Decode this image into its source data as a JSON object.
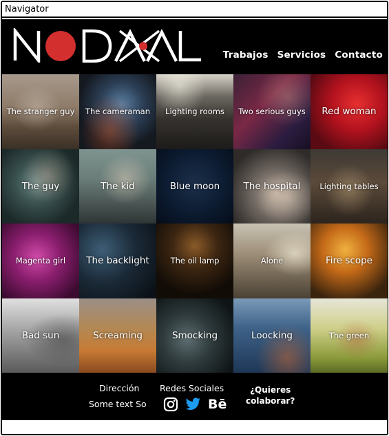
{
  "window": {
    "title": "Navigator"
  },
  "brand": {
    "logo_text": "NODAL",
    "accent": "#d32f2f"
  },
  "nav": {
    "items": [
      "Trabajos",
      "Servicios",
      "Contacto"
    ]
  },
  "grid": {
    "tiles": [
      "The stranger guy",
      "The cameraman",
      "Lighting rooms",
      "Two serious guys",
      "Red woman",
      "The guy",
      "The kid",
      "Blue moon",
      "The hospital",
      "Lighting tables",
      "Magenta girl",
      "The backlight",
      "The oil lamp",
      "Alone",
      "Fire scope",
      "Bad sun",
      "Screaming",
      "Smocking",
      "Loocking",
      "The green"
    ]
  },
  "footer": {
    "address_title": "Dirección",
    "address_text": "Some text So",
    "social_title": "Redes Sociales",
    "social_icons": [
      "instagram-icon",
      "twitter-icon",
      "behance-icon"
    ],
    "behance_label": "Bē",
    "cta_line1": "¿Quieres",
    "cta_line2": "colaborar?"
  }
}
